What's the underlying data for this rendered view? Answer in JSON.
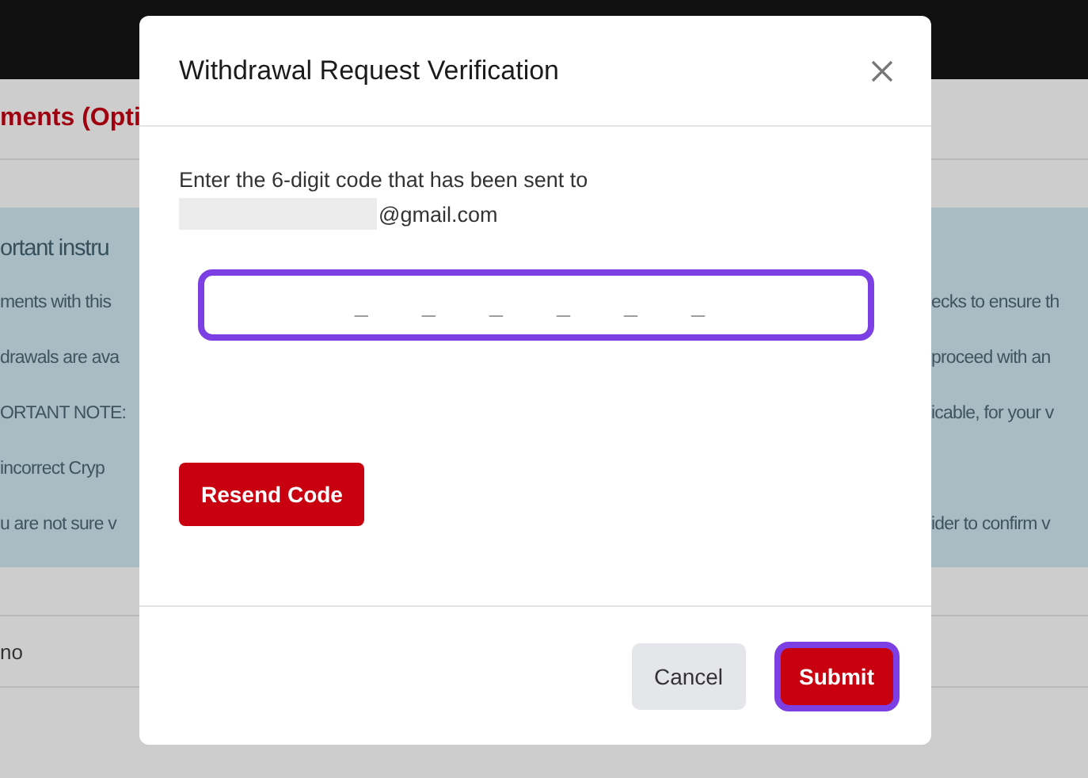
{
  "page": {
    "section_heading": "ments (Opti",
    "notice_title": "ortant instru",
    "notice_lines": [
      {
        "left": "ments with this",
        "right": "ecks to ensure th"
      },
      {
        "left": "drawals are ava",
        "right": "proceed with an"
      },
      {
        "left": "ORTANT NOTE:",
        "right": "icable, for your v"
      },
      {
        "left": "incorrect Cryp"
      },
      {
        "left": "u are not sure v",
        "right": "ider to confirm v"
      }
    ],
    "table_cell": "no"
  },
  "dialog": {
    "title": "Withdrawal Request Verification",
    "message": "Enter the 6-digit code that has been sent to",
    "email": "@gmail.com",
    "email_redacted": true,
    "code_field": {
      "placeholder": "_ _ _ _ _ _",
      "focused": true
    },
    "resend_button": "Resend Code",
    "cancel_button": "Cancel",
    "submit_button": "Submit",
    "submit_focused": true
  }
}
